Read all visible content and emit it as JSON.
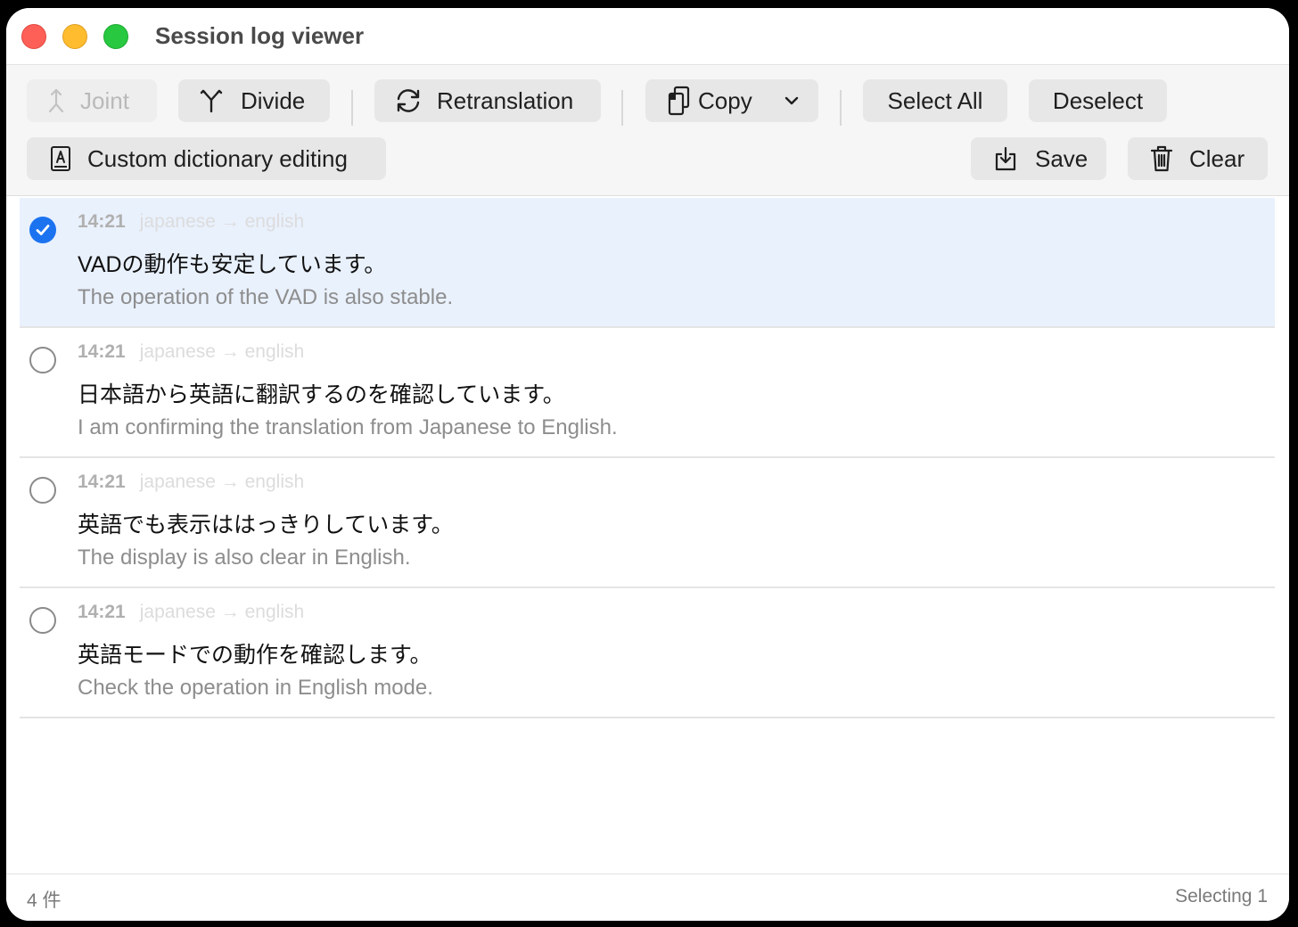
{
  "window": {
    "title": "Session log viewer"
  },
  "toolbar": {
    "joint_label": "Joint",
    "divide_label": "Divide",
    "retranslation_label": "Retranslation",
    "copy_label": "Copy",
    "select_all_label": "Select All",
    "deselect_label": "Deselect",
    "custom_dictionary_label": "Custom dictionary editing",
    "save_label": "Save",
    "clear_label": "Clear"
  },
  "entries": [
    {
      "selected": true,
      "time": "14:21",
      "direction": "japanese → english",
      "source": "VADの動作も安定しています。",
      "target": "The operation of the VAD is also stable."
    },
    {
      "selected": false,
      "time": "14:21",
      "direction": "japanese → english",
      "source": "日本語から英語に翻訳するのを確認しています。",
      "target": "I am confirming the translation from Japanese to English."
    },
    {
      "selected": false,
      "time": "14:21",
      "direction": "japanese → english",
      "source": "英語でも表示ははっきりしています。",
      "target": "The display is also clear in English."
    },
    {
      "selected": false,
      "time": "14:21",
      "direction": "japanese → english",
      "source": "英語モードでの動作を確認します。",
      "target": "Check the operation in English mode."
    }
  ],
  "footer": {
    "count": "4 件",
    "selection": "Selecting 1"
  },
  "colors": {
    "accent": "#1c73f0",
    "selected_row": "#e9f1fd",
    "close": "#fe5f57",
    "minimize": "#febc2e",
    "maximize": "#28c840"
  }
}
